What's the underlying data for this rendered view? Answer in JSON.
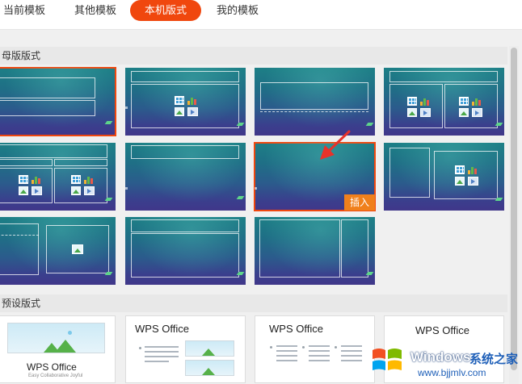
{
  "tabs": [
    {
      "label": "当前模板",
      "active": false
    },
    {
      "label": "其他模板",
      "active": false
    },
    {
      "label": "本机版式",
      "active": true
    },
    {
      "label": "我的模板",
      "active": false
    }
  ],
  "sections": {
    "master": {
      "title": "母版版式"
    },
    "preset": {
      "title": "预设版式"
    }
  },
  "insert_label": "插入",
  "preset_cards": [
    {
      "title": "WPS Office",
      "subtitle": "Easy Collaborative Joyful"
    },
    {
      "title": "WPS Office"
    },
    {
      "title": "WPS Office"
    },
    {
      "title": "WPS Office"
    }
  ],
  "watermark": {
    "brand": "Windows",
    "brand_cn": "系统之家",
    "url": "www.bjjmlv.com"
  },
  "colors": {
    "accent": "#f0470e",
    "insert": "#f0801c",
    "thumb_top": "#1d7f86",
    "thumb_bottom": "#40378a"
  }
}
